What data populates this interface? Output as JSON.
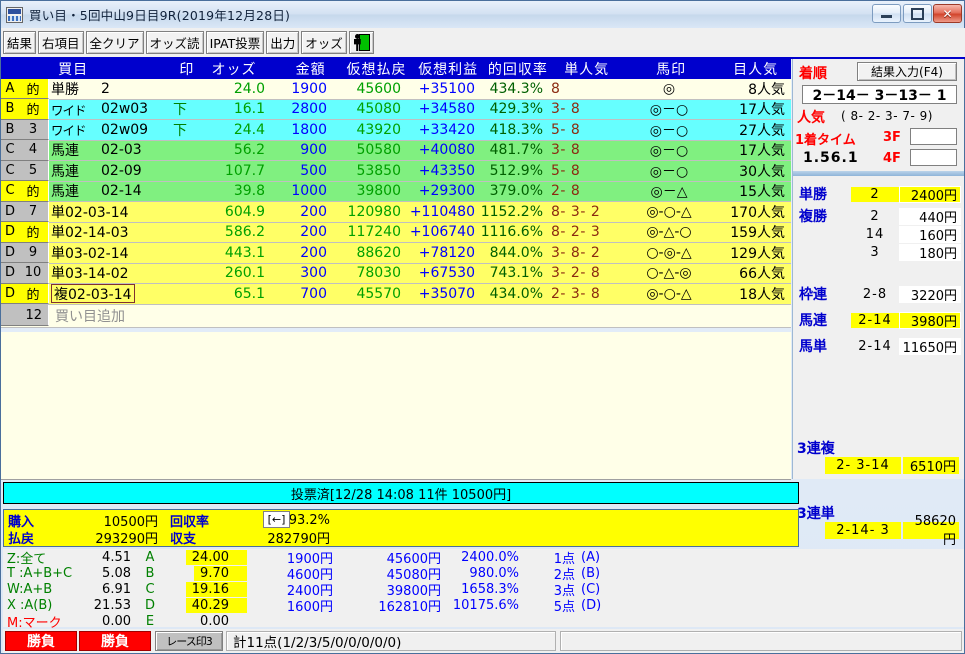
{
  "window": {
    "title": "買い目・5回中山9日目9R(2019年12月28日)",
    "icon": "app-icon",
    "minimize": "–",
    "maximize": "□",
    "close": "✕"
  },
  "toolbar": {
    "buttons": [
      {
        "label": "結果",
        "name": "result"
      },
      {
        "label": "右項目",
        "name": "right-items"
      },
      {
        "label": "全クリア",
        "name": "clear-all"
      },
      {
        "label": "オッズ読",
        "name": "odds-read"
      },
      {
        "label": "IPAT投票",
        "name": "ipat-vote"
      },
      {
        "label": "出力",
        "name": "output"
      },
      {
        "label": "オッズ",
        "name": "odds"
      }
    ],
    "exit_icon": "exit-person-icon"
  },
  "table": {
    "headers": {
      "id": "",
      "type": "買目",
      "mark": "印",
      "odds": "オッズ",
      "amount": "金額",
      "payout": "仮想払戻",
      "profit": "仮想利益",
      "rate": "的回収率",
      "tanpop": "単人気",
      "horsemark": "馬印",
      "mpop": "目人気"
    },
    "rows": [
      {
        "grp": "A",
        "num": "的",
        "hit": true,
        "type": "単勝",
        "sel": "2",
        "mark": "",
        "odds": "24.0",
        "amount": "1900",
        "payout": "45600",
        "profit": "+35100",
        "rate": "434.3%",
        "tanpop": "8",
        "horsemark": "◎",
        "mpop": "8人気",
        "bg": "ivory",
        "boxed": false
      },
      {
        "grp": "B",
        "num": "的",
        "hit": true,
        "type": "ワイド",
        "sel": "02w03",
        "mark": "下",
        "odds": "16.1",
        "amount": "2800",
        "payout": "45080",
        "profit": "+34580",
        "rate": "429.3%",
        "tanpop": "3- 8",
        "horsemark": "◎－○",
        "mpop": "17人気",
        "bg": "cyan",
        "boxed": false
      },
      {
        "grp": "B",
        "num": "3",
        "hit": false,
        "type": "ワイド",
        "sel": "02w09",
        "mark": "下",
        "odds": "24.4",
        "amount": "1800",
        "payout": "43920",
        "profit": "+33420",
        "rate": "418.3%",
        "tanpop": "5- 8",
        "horsemark": "◎－○",
        "mpop": "27人気",
        "bg": "cyan",
        "boxed": false
      },
      {
        "grp": "C",
        "num": "4",
        "hit": false,
        "type": "馬連",
        "sel": "02-03",
        "mark": "",
        "odds": "56.2",
        "amount": "900",
        "payout": "50580",
        "profit": "+40080",
        "rate": "481.7%",
        "tanpop": "3- 8",
        "horsemark": "◎－○",
        "mpop": "17人気",
        "bg": "green",
        "boxed": false
      },
      {
        "grp": "C",
        "num": "5",
        "hit": false,
        "type": "馬連",
        "sel": "02-09",
        "mark": "",
        "odds": "107.7",
        "amount": "500",
        "payout": "53850",
        "profit": "+43350",
        "rate": "512.9%",
        "tanpop": "5- 8",
        "horsemark": "◎－○",
        "mpop": "30人気",
        "bg": "green",
        "boxed": false
      },
      {
        "grp": "C",
        "num": "的",
        "hit": true,
        "type": "馬連",
        "sel": "02-14",
        "mark": "",
        "odds": "39.8",
        "amount": "1000",
        "payout": "39800",
        "profit": "+29300",
        "rate": "379.0%",
        "tanpop": "2- 8",
        "horsemark": "◎－△",
        "mpop": "15人気",
        "bg": "green",
        "boxed": false
      },
      {
        "grp": "D",
        "num": "7",
        "hit": false,
        "type": "単02-03-14",
        "sel": "",
        "mark": "",
        "odds": "604.9",
        "amount": "200",
        "payout": "120980",
        "profit": "+110480",
        "rate": "1152.2%",
        "tanpop": "8- 3- 2",
        "horsemark": "◎-○-△",
        "mpop": "170人気",
        "bg": "yellow",
        "boxed": false
      },
      {
        "grp": "D",
        "num": "的",
        "hit": true,
        "type": "単02-14-03",
        "sel": "",
        "mark": "",
        "odds": "586.2",
        "amount": "200",
        "payout": "117240",
        "profit": "+106740",
        "rate": "1116.6%",
        "tanpop": "8- 2- 3",
        "horsemark": "◎-△-○",
        "mpop": "159人気",
        "bg": "yellow",
        "boxed": false
      },
      {
        "grp": "D",
        "num": "9",
        "hit": false,
        "type": "単03-02-14",
        "sel": "",
        "mark": "",
        "odds": "443.1",
        "amount": "200",
        "payout": "88620",
        "profit": "+78120",
        "rate": "844.0%",
        "tanpop": "3- 8- 2",
        "horsemark": "○-◎-△",
        "mpop": "129人気",
        "bg": "yellow",
        "boxed": false
      },
      {
        "grp": "D",
        "num": "10",
        "hit": false,
        "type": "単03-14-02",
        "sel": "",
        "mark": "",
        "odds": "260.1",
        "amount": "300",
        "payout": "78030",
        "profit": "+67530",
        "rate": "743.1%",
        "tanpop": "3- 2- 8",
        "horsemark": "○-△-◎",
        "mpop": "66人気",
        "bg": "yellow",
        "boxed": false
      },
      {
        "grp": "D",
        "num": "的",
        "hit": true,
        "type": "複02-03-14",
        "sel": "",
        "mark": "",
        "odds": "65.1",
        "amount": "700",
        "payout": "45570",
        "profit": "+35070",
        "rate": "434.0%",
        "tanpop": "2- 3- 8",
        "horsemark": "◎-○-△",
        "mpop": "18人気",
        "bg": "yellow",
        "boxed": true
      }
    ],
    "add_row": {
      "num": "12",
      "label": "買い目追加"
    }
  },
  "right_panel": {
    "chakujun_label": "着順",
    "result_button": "結果入力(F4)",
    "order": "2－14－ 3－13－ 1",
    "ninki_label": "人気",
    "ninki_value": "( 8- 2- 3- 7- 9)",
    "time_label": "1着タイム",
    "time_value": "1.56.1",
    "f3_label": "3F",
    "f3_value": "",
    "f4_label": "4F",
    "f4_value": "",
    "payouts": [
      {
        "name": "単勝",
        "num": "2",
        "amount": "2400円",
        "hl": true
      },
      {
        "name": "複勝",
        "num": "2",
        "amount": "440円",
        "hl": false
      },
      {
        "name": "",
        "num": "14",
        "amount": "160円",
        "hl": false
      },
      {
        "name": "",
        "num": "3",
        "amount": "180円",
        "hl": false
      },
      {
        "name": "枠連",
        "num": "2-8",
        "amount": "3220円",
        "hl": false
      },
      {
        "name": "馬連",
        "num": "2-14",
        "amount": "3980円",
        "hl": true
      },
      {
        "name": "馬単",
        "num": "2-14",
        "amount": "11650円",
        "hl": false
      }
    ],
    "sanrenpuku": {
      "name": "3連複",
      "num": "2- 3-14",
      "amount": "6510円",
      "hl": true
    },
    "sanrentan": {
      "name": "3連単",
      "num": "2-14- 3",
      "amount": "58620円",
      "hl": true
    }
  },
  "vote_bar": "投票済[12/28 14:08 11件 10500円]",
  "summary": {
    "purchase_label": "購入",
    "purchase_value": "10500円",
    "rate_label": "回収率",
    "rate_value": "2793.2%",
    "payout_label": "払戻",
    "payout_value": "293290円",
    "balance_label": "収支",
    "balance_value": "282790円",
    "back_button": "[←]"
  },
  "stats": {
    "rows": [
      {
        "key": "Z:全て",
        "key_color": "green",
        "val": "4.51",
        "letter": "A",
        "odds": "24.00",
        "odds_hl": true,
        "amount": "1900円",
        "payout": "45600円",
        "rate": "2400.0%",
        "points": "1点",
        "grp": "(A)"
      },
      {
        "key": "T :A+B+C",
        "key_color": "green",
        "val": "5.08",
        "letter": "B",
        "odds": "9.70",
        "odds_hl": true,
        "amount": "4600円",
        "payout": "45080円",
        "rate": "980.0%",
        "points": "2点",
        "grp": "(B)"
      },
      {
        "key": "W:A+B",
        "key_color": "green",
        "val": "6.91",
        "letter": "C",
        "odds": "19.16",
        "odds_hl": true,
        "amount": "2400円",
        "payout": "39800円",
        "rate": "1658.3%",
        "points": "3点",
        "grp": "(C)"
      },
      {
        "key": "X :A(B)",
        "key_color": "green",
        "val": "21.53",
        "letter": "D",
        "odds": "40.29",
        "odds_hl": true,
        "amount": "1600円",
        "payout": "162810円",
        "rate": "10175.6%",
        "points": "5点",
        "grp": "(D)"
      },
      {
        "key": "M:マーク",
        "key_color": "red",
        "val": "0.00",
        "letter": "E",
        "odds": "0.00",
        "odds_hl": false,
        "amount": "",
        "payout": "",
        "rate": "",
        "points": "",
        "grp": ""
      }
    ]
  },
  "bottom": {
    "button1": "勝負",
    "button2": "勝負",
    "race_mark": "レース印3",
    "total": "計11点(1/2/3/5/0/0/0/0/0)"
  },
  "colors": {
    "header_blue": "#0000cd",
    "hit_yellow": "#ffff00",
    "cyan": "#66ffff",
    "green": "#80f080",
    "yellow": "#ffff66",
    "ivory": "#ffffe8"
  }
}
